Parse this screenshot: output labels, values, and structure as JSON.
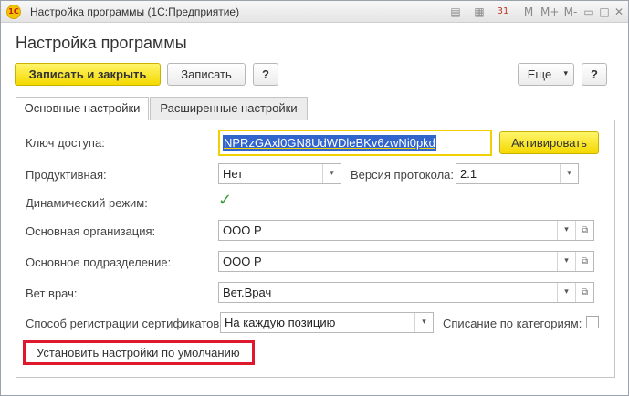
{
  "window": {
    "title": "Настройка программы (1С:Предприятие)",
    "logo_text": "1С",
    "title_icons": [
      "calendar-icon",
      "document-icon",
      "calendar-31-icon",
      "memory-m-icon",
      "memory-mplus-icon",
      "memory-mminus-icon",
      "minimize-icon",
      "restore-icon",
      "close-icon"
    ],
    "title_glyphs": {
      "calendar": "▤",
      "document": "▦",
      "calendar31": "31",
      "m": "M",
      "mplus": "M+",
      "mminus": "M-",
      "minimize": "▭",
      "restore": "□",
      "close": "✕"
    }
  },
  "heading": "Настройка программы",
  "toolbar": {
    "save_close_label": "Записать и закрыть",
    "save_label": "Записать",
    "help_label": "?",
    "more_label": "Еще",
    "more_arrow": "▾",
    "help2_label": "?"
  },
  "tabs": [
    {
      "label": "Основные настройки",
      "active": true
    },
    {
      "label": "Расширенные настройки",
      "active": false
    }
  ],
  "form": {
    "access_key_label": "Ключ доступа:",
    "access_key_value": "NPRzGAxl0GN8UdWDleBKv6zwNi0pkd",
    "activate_label": "Активировать",
    "productive_label": "Продуктивная:",
    "productive_value": "Нет",
    "protocol_label": "Версия протокола:",
    "protocol_value": "2.1",
    "dynamic_label": "Динамический режим:",
    "dynamic_checked": true,
    "check_glyph": "✓",
    "org_label": "Основная организация:",
    "org_value": "ООО Р",
    "division_label": "Основное подразделение:",
    "division_value": "ООО Р",
    "vet_label": "Вет врач:",
    "vet_value": "Вет.Врач",
    "cert_method_label": "Способ регистрации сертификатов:",
    "cert_method_value": "На каждую позицию",
    "writeoff_label": "Списание по категориям:",
    "writeoff_checked": false,
    "default_button_label": "Установить настройки по умолчанию",
    "dropdown_glyph": "▾",
    "open_glyph": "⧉"
  },
  "colors": {
    "accent_yellow": "#f4d800",
    "highlight_red": "#e0182d",
    "selection_blue": "#3366cc",
    "check_green": "#3a9c3a"
  }
}
